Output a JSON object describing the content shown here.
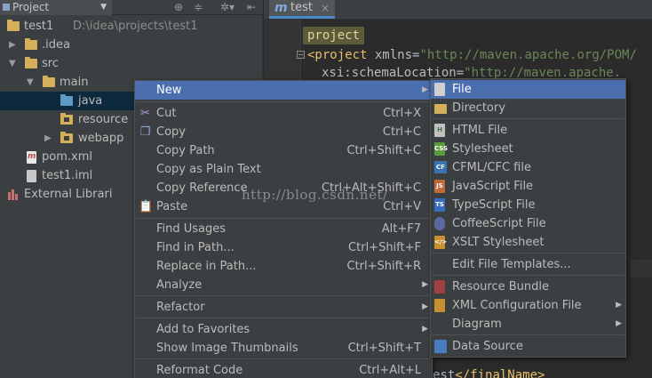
{
  "project_panel": {
    "title": "Project",
    "tree": [
      {
        "label": "test1",
        "path": "D:\\idea\\projects\\test1"
      },
      {
        "label": ".idea"
      },
      {
        "label": "src"
      },
      {
        "label": "main"
      },
      {
        "label": "java"
      },
      {
        "label": "resource"
      },
      {
        "label": "webapp"
      },
      {
        "label": "pom.xml"
      },
      {
        "label": "test1.iml"
      },
      {
        "label": "External Librari"
      }
    ]
  },
  "editor": {
    "tab_label": "test",
    "breadcrumb": "project",
    "lines": [
      {
        "tag_open": "<project ",
        "attr": "xmlns",
        "eq": "=",
        "value": "\"http://maven.apache.org/POM/"
      },
      {
        "attr": "xsi:schemaLocation",
        "eq": "=",
        "value": "\"http://maven.apache."
      }
    ],
    "bottom_line": {
      "plain": "est",
      "tag": "</finalName>"
    }
  },
  "context_menu": {
    "items": [
      {
        "label": "New",
        "shortcut": "",
        "submenu": true
      },
      {
        "label": "Cut",
        "shortcut": "Ctrl+X"
      },
      {
        "label": "Copy",
        "shortcut": "Ctrl+C"
      },
      {
        "label": "Copy Path",
        "shortcut": "Ctrl+Shift+C"
      },
      {
        "label": "Copy as Plain Text",
        "shortcut": ""
      },
      {
        "label": "Copy Reference",
        "shortcut": "Ctrl+Alt+Shift+C"
      },
      {
        "label": "Paste",
        "shortcut": "Ctrl+V"
      },
      {
        "label": "Find Usages",
        "shortcut": "Alt+F7"
      },
      {
        "label": "Find in Path...",
        "shortcut": "Ctrl+Shift+F"
      },
      {
        "label": "Replace in Path...",
        "shortcut": "Ctrl+Shift+R"
      },
      {
        "label": "Analyze",
        "shortcut": "",
        "submenu": true
      },
      {
        "label": "Refactor",
        "shortcut": "",
        "submenu": true
      },
      {
        "label": "Add to Favorites",
        "shortcut": "",
        "submenu": true
      },
      {
        "label": "Show Image Thumbnails",
        "shortcut": "Ctrl+Shift+T"
      },
      {
        "label": "Reformat Code",
        "shortcut": "Ctrl+Alt+L"
      }
    ]
  },
  "new_submenu": {
    "items": [
      {
        "label": "File"
      },
      {
        "label": "Directory"
      },
      {
        "label": "HTML File",
        "icon_text": "H"
      },
      {
        "label": "Stylesheet",
        "icon_text": "CSS"
      },
      {
        "label": "CFML/CFC file",
        "icon_text": "CF"
      },
      {
        "label": "JavaScript File",
        "icon_text": "JS"
      },
      {
        "label": "TypeScript File",
        "icon_text": "TS"
      },
      {
        "label": "CoffeeScript File",
        "icon_text": ""
      },
      {
        "label": "XSLT Stylesheet",
        "icon_text": "</>"
      },
      {
        "label": "Edit File Templates..."
      },
      {
        "label": "Resource Bundle"
      },
      {
        "label": "XML Configuration File",
        "submenu": true
      },
      {
        "label": "Diagram",
        "submenu": true
      },
      {
        "label": "Data Source"
      }
    ]
  },
  "watermark": "http://blog.csdn.net/",
  "colors": {
    "menu_highlight": "#4b6eaf",
    "panel_bg": "#3c3f41",
    "editor_bg": "#2b2b2b",
    "selection_bg": "#0d293e",
    "xml_tag": "#e8bf6a",
    "xml_string": "#6a8759"
  }
}
